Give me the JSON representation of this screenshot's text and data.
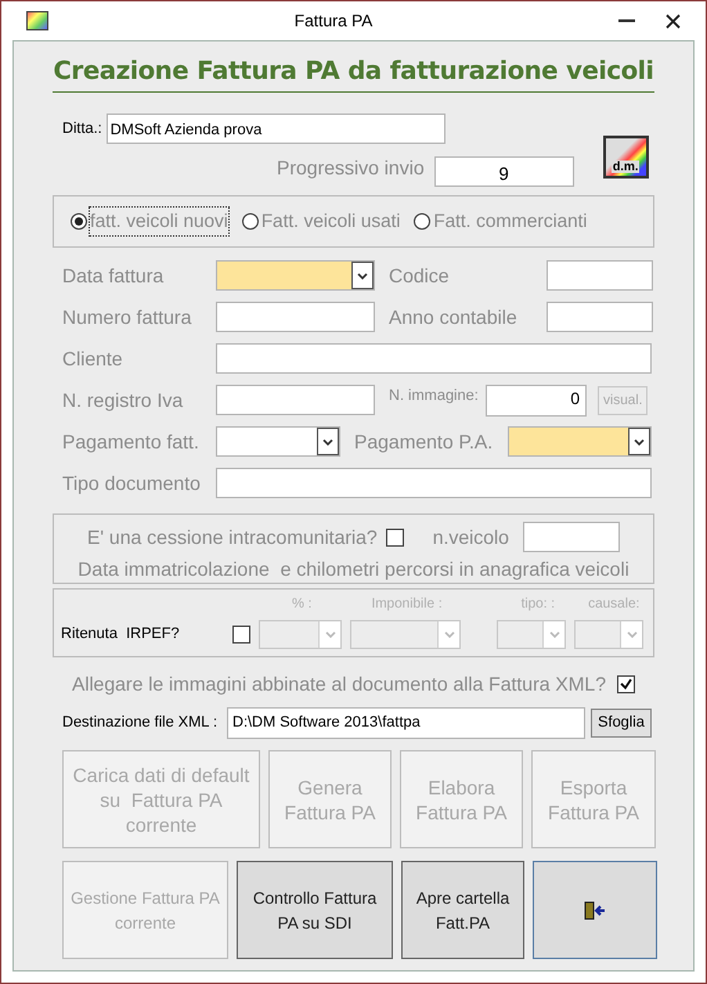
{
  "window": {
    "title": "Fattura PA"
  },
  "heading": "Creazione Fattura PA da fatturazione veicoli",
  "ditta": {
    "label": "Ditta.:",
    "value": "DMSoft Azienda prova"
  },
  "progressivo": {
    "label": "Progressivo invio",
    "value": "9"
  },
  "logo_button": {
    "text": "d.m."
  },
  "invoice_types": [
    {
      "label": "fatt. veicoli nuovi",
      "selected": true
    },
    {
      "label": "Fatt. veicoli usati",
      "selected": false
    },
    {
      "label": "Fatt. commercianti",
      "selected": false
    }
  ],
  "rows": [
    {
      "left": {
        "label": "Data fattura",
        "kind": "dropdown",
        "highlighted": true
      },
      "right": {
        "label": "Codice",
        "kind": "text"
      }
    },
    {
      "left": {
        "label": "Numero fattura",
        "kind": "text"
      },
      "right": {
        "label": "Anno contabile",
        "kind": "text"
      }
    },
    {
      "left": {
        "label": "Cliente",
        "kind": "wide"
      }
    },
    {
      "left": {
        "label": "N. registro Iva",
        "kind": "text"
      },
      "right": {
        "label": "N. immagine:",
        "kind": "number",
        "value": "0",
        "button": "visual."
      }
    },
    {
      "left": {
        "label": "Pagamento fatt.",
        "kind": "dropdown",
        "highlighted": false
      },
      "right": {
        "label": "Pagamento P.A.",
        "kind": "dropdown",
        "highlighted": true
      }
    },
    {
      "left": {
        "label": "Tipo documento",
        "kind": "wide"
      }
    }
  ],
  "intracom": {
    "question": "E' una cessione intracomunitaria?",
    "checked": false,
    "vehicle_label": "n.veicolo",
    "note": "Data immatricolazione  e chilometri percorsi in anagrafica veicoli"
  },
  "ritenuta": {
    "label": "Ritenuta  IRPEF?",
    "checked": false,
    "columns": [
      "% :",
      "Imponibile :",
      "tipo: :",
      "causale:"
    ]
  },
  "allegare": {
    "label": "Allegare le immagini abbinate al documento alla Fattura XML?",
    "checked": true
  },
  "destinazione": {
    "label": "Destinazione file XML :",
    "value": "D:\\DM Software 2013\\fattpa",
    "button": "Sfoglia"
  },
  "button_rows": [
    [
      {
        "label": "Carica dati di default\nsu  Fattura PA\ncorrente",
        "disabled": true
      },
      {
        "label": "Genera\nFattura PA",
        "disabled": true
      },
      {
        "label": "Elabora\nFattura PA",
        "disabled": true
      },
      {
        "label": "Esporta\nFattura PA",
        "disabled": true
      }
    ],
    [
      {
        "label": "Gestione Fattura PA\ncorrente",
        "disabled": true
      },
      {
        "label": "Controllo Fattura\nPA su SDI",
        "disabled": false
      },
      {
        "label": "Apre cartella\nFatt.PA",
        "disabled": false
      },
      {
        "kind": "exit",
        "disabled": false
      }
    ]
  ]
}
